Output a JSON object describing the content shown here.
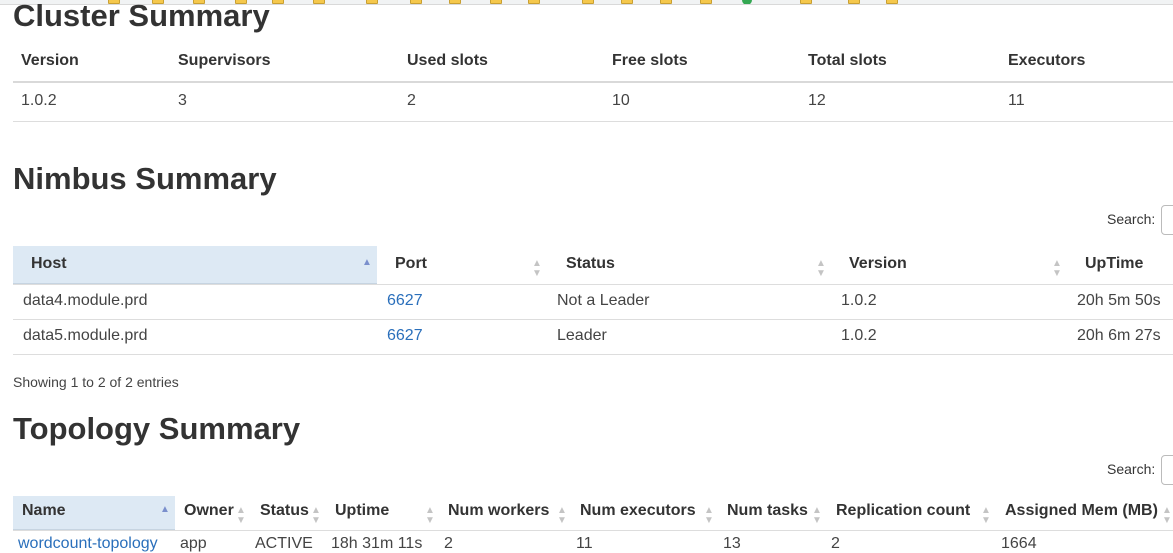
{
  "cluster": {
    "title": "Cluster Summary",
    "headers": [
      "Version",
      "Supervisors",
      "Used slots",
      "Free slots",
      "Total slots",
      "Executors"
    ],
    "row": [
      "1.0.2",
      "3",
      "2",
      "10",
      "12",
      "11"
    ]
  },
  "nimbus": {
    "title": "Nimbus Summary",
    "search_label": "Search:",
    "headers": [
      "Host",
      "Port",
      "Status",
      "Version",
      "UpTime"
    ],
    "rows": [
      [
        "data4.module.prd",
        "6627",
        "Not a Leader",
        "1.0.2",
        "20h 5m 50s"
      ],
      [
        "data5.module.prd",
        "6627",
        "Leader",
        "1.0.2",
        "20h 6m 27s"
      ]
    ],
    "info": "Showing 1 to 2 of 2 entries"
  },
  "topology": {
    "title": "Topology Summary",
    "search_label": "Search:",
    "headers": [
      "Name",
      "Owner",
      "Status",
      "Uptime",
      "Num workers",
      "Num executors",
      "Num tasks",
      "Replication count",
      "Assigned Mem (MB)"
    ],
    "row": [
      "wordcount-topology",
      "app",
      "ACTIVE",
      "18h 31m 11s",
      "2",
      "11",
      "13",
      "2",
      "1664"
    ]
  },
  "colors": {
    "link": "#2a6fbb",
    "sorted_header_bg": "#dde9f4",
    "divider": "#dddddd"
  }
}
